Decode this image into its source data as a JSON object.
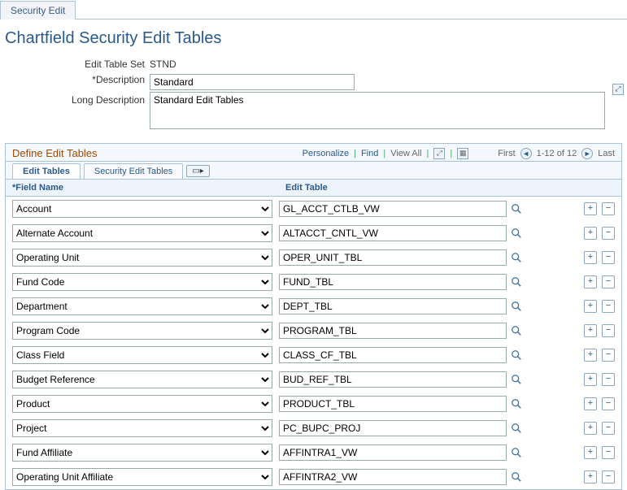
{
  "page_tab": "Security Edit",
  "page_title": "Chartfield Security Edit Tables",
  "labels": {
    "edit_table_set": "Edit Table Set",
    "description": "*Description",
    "long_description": "Long Description"
  },
  "values": {
    "edit_table_set": "STND",
    "description": "Standard",
    "long_description": "Standard Edit Tables"
  },
  "grid": {
    "title": "Define Edit Tables",
    "tools": {
      "personalize": "Personalize",
      "find": "Find",
      "view_all": "View All",
      "first": "First",
      "range": "1-12 of 12",
      "last": "Last"
    },
    "tabs": {
      "edit_tables": "Edit Tables",
      "security_edit_tables": "Security Edit Tables"
    },
    "columns": {
      "field_name": "*Field Name",
      "edit_table": "Edit Table"
    },
    "rows": [
      {
        "field_name": "Account",
        "edit_table": "GL_ACCT_CTLB_VW"
      },
      {
        "field_name": "Alternate Account",
        "edit_table": "ALTACCT_CNTL_VW"
      },
      {
        "field_name": "Operating Unit",
        "edit_table": "OPER_UNIT_TBL"
      },
      {
        "field_name": "Fund Code",
        "edit_table": "FUND_TBL"
      },
      {
        "field_name": "Department",
        "edit_table": "DEPT_TBL"
      },
      {
        "field_name": "Program Code",
        "edit_table": "PROGRAM_TBL"
      },
      {
        "field_name": "Class Field",
        "edit_table": "CLASS_CF_TBL"
      },
      {
        "field_name": "Budget Reference",
        "edit_table": "BUD_REF_TBL"
      },
      {
        "field_name": "Product",
        "edit_table": "PRODUCT_TBL"
      },
      {
        "field_name": "Project",
        "edit_table": "PC_BUPC_PROJ"
      },
      {
        "field_name": "Fund Affiliate",
        "edit_table": "AFFINTRA1_VW"
      },
      {
        "field_name": "Operating Unit Affiliate",
        "edit_table": "AFFINTRA2_VW"
      }
    ]
  }
}
